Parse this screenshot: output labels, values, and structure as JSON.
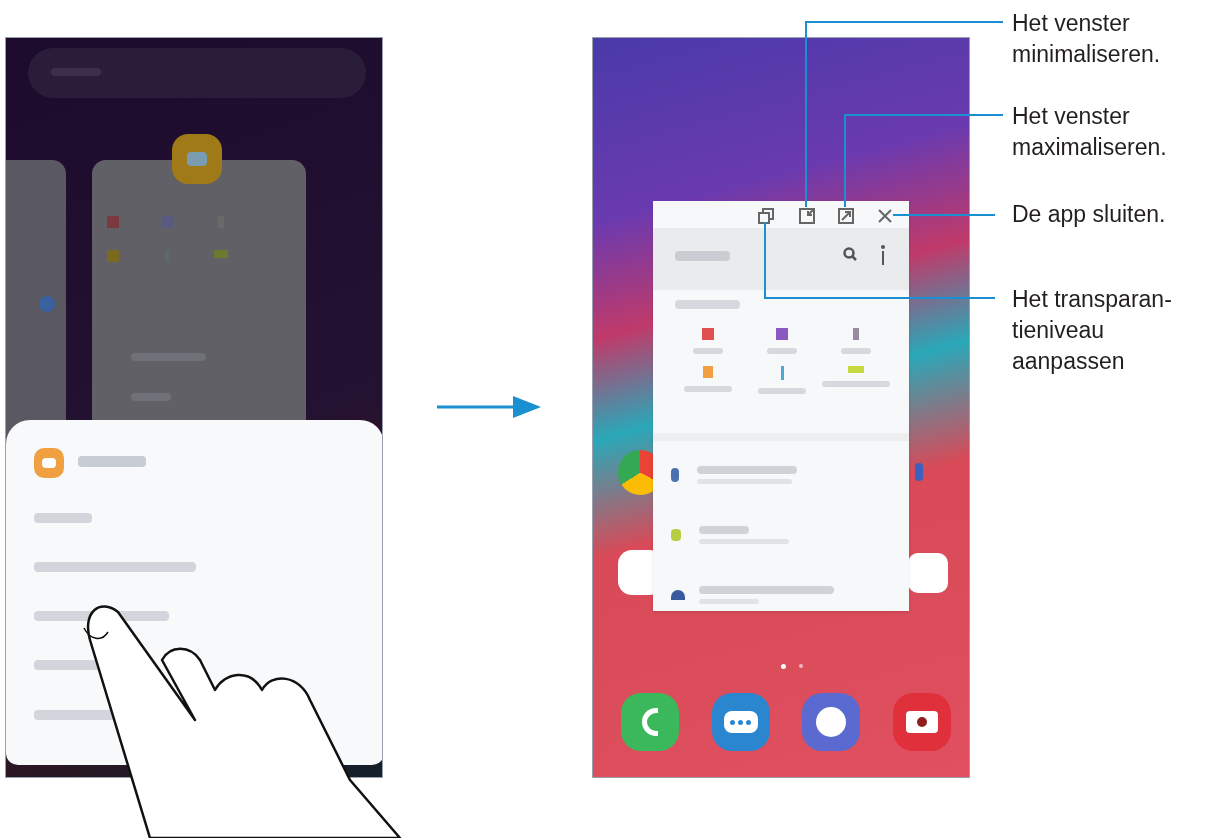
{
  "callouts": [
    {
      "kind": "minimize",
      "lines": [
        "Het venster",
        "minimaliseren."
      ]
    },
    {
      "kind": "maximize",
      "lines": [
        "Het venster",
        "maximaliseren."
      ]
    },
    {
      "kind": "close",
      "lines": [
        "De app sluiten."
      ]
    },
    {
      "kind": "transparency",
      "lines": [
        "Het transparan-",
        "tieniveau",
        "aanpassen"
      ]
    }
  ]
}
